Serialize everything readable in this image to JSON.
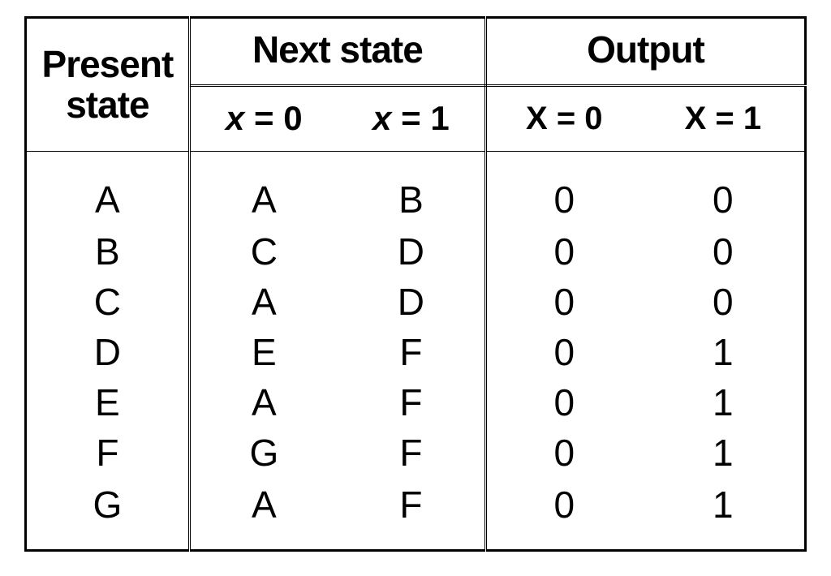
{
  "headers": {
    "present": "Present\nstate",
    "next_state": "Next state",
    "output": "Output"
  },
  "sub_headers": {
    "next_x0_a": "x",
    "next_x0_b": "  =  0",
    "next_x1_a": "x",
    "next_x1_b": "  =  1",
    "out_x0": "X  = 0",
    "out_x1": "X = 1"
  },
  "rows": [
    {
      "present": "A",
      "n0": "A",
      "n1": "B",
      "o0": "0",
      "o1": "0"
    },
    {
      "present": "B",
      "n0": "C",
      "n1": "D",
      "o0": "0",
      "o1": "0"
    },
    {
      "present": "C",
      "n0": "A",
      "n1": "D",
      "o0": "0",
      "o1": "0"
    },
    {
      "present": "D",
      "n0": "E",
      "n1": "F",
      "o0": "0",
      "o1": "1"
    },
    {
      "present": "E",
      "n0": "A",
      "n1": "F",
      "o0": "0",
      "o1": "1"
    },
    {
      "present": "F",
      "n0": "G",
      "n1": "F",
      "o0": "0",
      "o1": "1"
    },
    {
      "present": "G",
      "n0": "A",
      "n1": "F",
      "o0": "0",
      "o1": "1"
    }
  ],
  "chart_data": {
    "type": "table",
    "title": "State transition table",
    "columns": [
      "Present state",
      "Next state (x=0)",
      "Next state (x=1)",
      "Output (X=0)",
      "Output (X=1)"
    ],
    "rows": [
      [
        "A",
        "A",
        "B",
        0,
        0
      ],
      [
        "B",
        "C",
        "D",
        0,
        0
      ],
      [
        "C",
        "A",
        "D",
        0,
        0
      ],
      [
        "D",
        "E",
        "F",
        0,
        1
      ],
      [
        "E",
        "A",
        "F",
        0,
        1
      ],
      [
        "F",
        "G",
        "F",
        0,
        1
      ],
      [
        "G",
        "A",
        "F",
        0,
        1
      ]
    ]
  }
}
